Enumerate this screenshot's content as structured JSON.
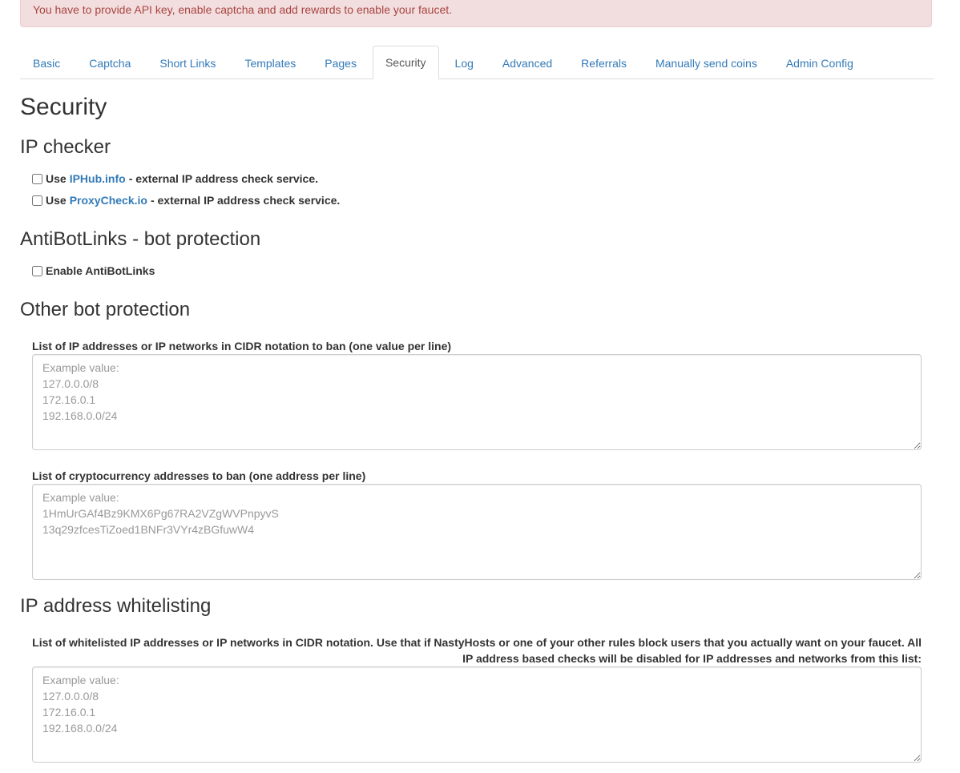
{
  "alert": {
    "text": "You have to provide API key, enable captcha and add rewards to enable your faucet."
  },
  "tabs": [
    {
      "label": "Basic",
      "active": false
    },
    {
      "label": "Captcha",
      "active": false
    },
    {
      "label": "Short Links",
      "active": false
    },
    {
      "label": "Templates",
      "active": false
    },
    {
      "label": "Pages",
      "active": false
    },
    {
      "label": "Security",
      "active": true
    },
    {
      "label": "Log",
      "active": false
    },
    {
      "label": "Advanced",
      "active": false
    },
    {
      "label": "Referrals",
      "active": false
    },
    {
      "label": "Manually send coins",
      "active": false
    },
    {
      "label": "Admin Config",
      "active": false
    }
  ],
  "page_title": "Security",
  "ip_checker": {
    "heading": "IP checker",
    "iphub": {
      "prefix": "Use",
      "link": "IPHub.info",
      "suffix": "- external IP address check service.",
      "checked": false
    },
    "proxycheck": {
      "prefix": "Use",
      "link": "ProxyCheck.io",
      "suffix": "- external IP address check service.",
      "checked": false
    }
  },
  "antibot": {
    "heading": "AntiBotLinks - bot protection",
    "enable_label": "Enable AntiBotLinks",
    "checked": false
  },
  "other_bot": {
    "heading": "Other bot protection",
    "ip_ban_label": "List of IP addresses or IP networks in CIDR notation to ban (one value per line)",
    "ip_ban_placeholder": "Example value:\n127.0.0.0/8\n172.16.0.1\n192.168.0.0/24",
    "ip_ban_value": "",
    "crypto_ban_label": "List of cryptocurrency addresses to ban (one address per line)",
    "crypto_ban_placeholder": "Example value:\n1HmUrGAf4Bz9KMX6Pg67RA2VZgWVPnpyvS\n13q29zfcesTiZoed1BNFr3VYr4zBGfuwW4",
    "crypto_ban_value": ""
  },
  "whitelist": {
    "heading": "IP address whitelisting",
    "label": "List of whitelisted IP addresses or IP networks in CIDR notation. Use that if NastyHosts or one of your other rules block users that you actually want on your faucet. All IP address based checks will be disabled for IP addresses and networks from this list:",
    "placeholder": "Example value:\n127.0.0.0/8\n172.16.0.1\n192.168.0.0/24",
    "value": ""
  }
}
